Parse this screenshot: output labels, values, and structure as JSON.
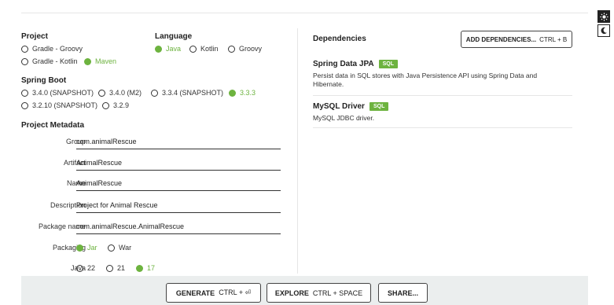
{
  "project": {
    "title": "Project",
    "options": [
      "Gradle - Groovy",
      "Gradle - Kotlin",
      "Maven"
    ],
    "selected": "Maven"
  },
  "language": {
    "title": "Language",
    "options": [
      "Java",
      "Kotlin",
      "Groovy"
    ],
    "selected": "Java"
  },
  "spring_boot": {
    "title": "Spring Boot",
    "options": [
      "3.4.0 (SNAPSHOT)",
      "3.4.0 (M2)",
      "3.3.4 (SNAPSHOT)",
      "3.3.3",
      "3.2.10 (SNAPSHOT)",
      "3.2.9"
    ],
    "selected": "3.3.3"
  },
  "metadata": {
    "title": "Project Metadata",
    "group_label": "Group",
    "group_value": "com.animalRescue",
    "artifact_label": "Artifact",
    "artifact_value": "AnimalRescue",
    "name_label": "Name",
    "name_value": "AnimalRescue",
    "description_label": "Description",
    "description_value": "Project for Animal Rescue",
    "package_label": "Package name",
    "package_value": "com.animalRescue.AnimalRescue",
    "packaging_label": "Packaging",
    "packaging_options": [
      "Jar",
      "War"
    ],
    "packaging_selected": "Jar",
    "java_label": "Java",
    "java_options": [
      "22",
      "21",
      "17"
    ],
    "java_selected": "17"
  },
  "dependencies": {
    "title": "Dependencies",
    "add_button": "ADD DEPENDENCIES...",
    "add_shortcut": "CTRL + B",
    "items": [
      {
        "name": "Spring Data JPA",
        "badge": "SQL",
        "description": "Persist data in SQL stores with Java Persistence API using Spring Data and Hibernate."
      },
      {
        "name": "MySQL Driver",
        "badge": "SQL",
        "description": "MySQL JDBC driver."
      }
    ]
  },
  "footer": {
    "generate_label": "GENERATE",
    "generate_shortcut": "CTRL + ⏎",
    "explore_label": "EXPLORE",
    "explore_shortcut": "CTRL + SPACE",
    "share_label": "SHARE..."
  },
  "theme": {
    "accent": "#6db33f",
    "icons": [
      "sun-icon",
      "moon-icon"
    ]
  }
}
